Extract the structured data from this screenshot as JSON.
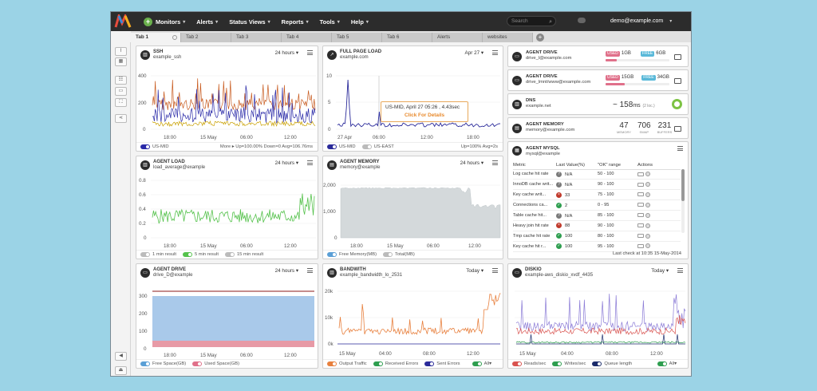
{
  "nav": {
    "items": [
      "Monitors",
      "Alerts",
      "Status Views",
      "Reports",
      "Tools",
      "Help"
    ],
    "search_placeholder": "Search",
    "user": "demo@example.com"
  },
  "tabs": [
    "Tab 1",
    "Tab 2",
    "Tab 3",
    "Tab 4",
    "Tab 5",
    "Tab 6",
    "Alerts",
    "websites"
  ],
  "widgets": {
    "ssh": {
      "title": "SSH",
      "sub": "example_ssh",
      "range": "24 hours",
      "legend": "US-MID",
      "stats": "More ▸   Up=100.00%   Down=0   Avg=106.76ms",
      "yticks": [
        "400",
        "200",
        "0"
      ],
      "xticks": [
        "18:00",
        "15 May",
        "06:00",
        "12:00"
      ]
    },
    "fullpage": {
      "title": "FULL PAGE LOAD",
      "sub": "example.com",
      "range": "Apr 27",
      "legend": [
        "US-MID",
        "US-EAST"
      ],
      "stats": "Up=100%  Avg=2s",
      "yticks": [
        "10",
        "5",
        "0"
      ],
      "xticks": [
        "27 Apr",
        "06:00",
        "12:00",
        "18:00"
      ],
      "tooltip": "US-MID, April 27 05:26 , 4.43sec",
      "tooltip_link": "Click For Details"
    },
    "agentload": {
      "title": "AGENT LOAD",
      "sub": "load_average@example",
      "range": "24 hours",
      "legend": [
        "1 min result",
        "5 min result",
        "15 min result"
      ],
      "yticks": [
        "0.8",
        "0.6",
        "0.4",
        "0.2",
        "0"
      ],
      "xticks": [
        "18:00",
        "15 May",
        "06:00",
        "12:00"
      ]
    },
    "agentmem": {
      "title": "AGENT MEMORY",
      "sub": "memory@example",
      "range": "24 hours",
      "legend": [
        "Free Memory(MB)",
        "Total(MB)"
      ],
      "yticks": [
        "2,000",
        "1,000",
        "0"
      ],
      "xticks": [
        "18:00",
        "15 May",
        "06:00",
        "12:00"
      ]
    },
    "agentdrive": {
      "title": "AGENT DRIVE",
      "sub": "drive_D@example",
      "range": "24 hours",
      "legend": [
        "Free Space(GB)",
        "Used Space(GB)"
      ],
      "yticks": [
        "300",
        "200",
        "100",
        "0"
      ],
      "xticks": [
        "18:00",
        "15 May",
        "06:00",
        "12:00"
      ]
    },
    "bandwidth": {
      "title": "BANDWITH",
      "sub": "example_bandwidth_lo_2531",
      "range": "Today",
      "legend": [
        "Output Traffic",
        "Received Errors",
        "Sent Errors"
      ],
      "all": "All",
      "yticks": [
        "20k",
        "10k",
        "0k"
      ],
      "xticks": [
        "15 May",
        "04:00",
        "08:00",
        "12:00"
      ]
    },
    "diskio": {
      "title": "DISKIO",
      "sub": "example-aws_diskio_xvdf_4435",
      "range": "Today",
      "legend": [
        "Reads/sec",
        "Writes/sec",
        "Queue length"
      ],
      "all": "All",
      "xticks": [
        "15 May",
        "04:00",
        "08:00",
        "12:00"
      ]
    }
  },
  "cards": {
    "drive1": {
      "title": "AGENT DRIVE",
      "sub": "drive_l@example.com",
      "used_label": "USED",
      "used": "1GB",
      "free_label": "FREE",
      "free": "6GB"
    },
    "drive2": {
      "title": "AGENT DRIVE",
      "sub": "drive_lmnt/www@example.com",
      "used_label": "USED",
      "used": "15GB",
      "free_label": "FREE",
      "free": "34GB"
    },
    "dns": {
      "title": "DNS",
      "sub": "example.net",
      "value": "~ 158",
      "unit": "ms",
      "note": "(2 loc.)"
    },
    "mem": {
      "title": "AGENT MEMORY",
      "sub": "memory@example.com",
      "vals": [
        "47",
        "706",
        "231"
      ],
      "labels": [
        "MEMORY",
        "SWAP",
        "BUFFERS"
      ]
    },
    "mysql": {
      "title": "AGENT MYSQL",
      "sub": "mysql@example",
      "headers": [
        "Metric",
        "Last Value(%)",
        "\"OK\" range",
        "Actions"
      ],
      "rows": [
        [
          "Log cache hit rate",
          "gray",
          "N/A",
          "50 - 100"
        ],
        [
          "InnoDB cache writ...",
          "gray",
          "N/A",
          "90 - 100"
        ],
        [
          "Key cache writ...",
          "red",
          "33",
          "75 - 100"
        ],
        [
          "Connections ca...",
          "green",
          "2",
          "0 - 95"
        ],
        [
          "Table cache hit...",
          "gray",
          "N/A",
          "85 - 100"
        ],
        [
          "Heavy join hit rate",
          "red",
          "88",
          "90 - 100"
        ],
        [
          "Tmp cache hit rate",
          "green",
          "100",
          "80 - 100"
        ],
        [
          "Key cache hit r...",
          "green",
          "100",
          "95 - 100"
        ]
      ],
      "footer": "Last check at 10:35 15-May-2014"
    }
  }
}
